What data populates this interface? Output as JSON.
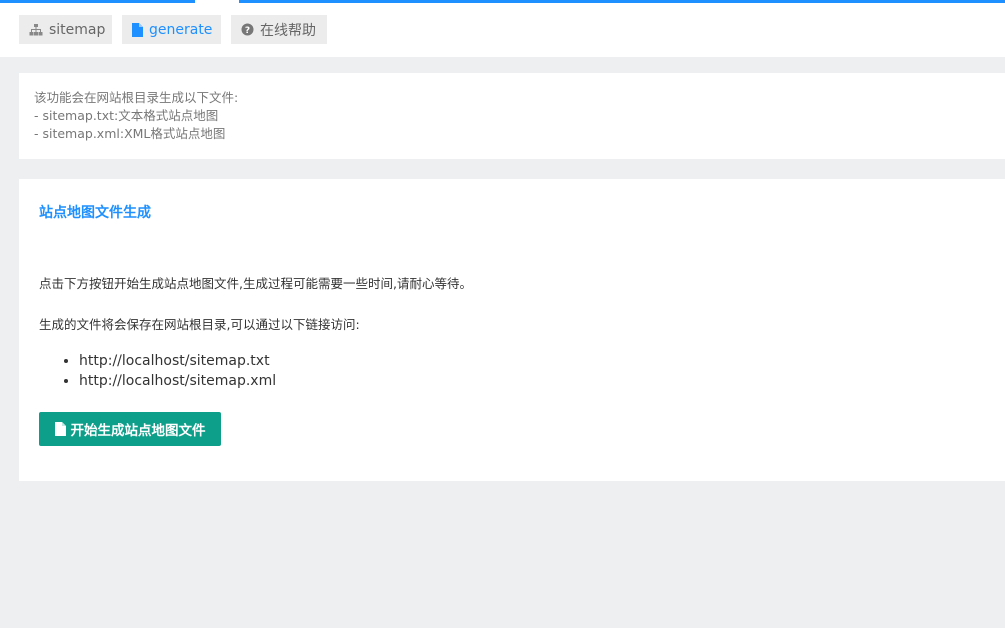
{
  "tabs": [
    {
      "label": "sitemap",
      "icon": "sitemap-icon",
      "active": false
    },
    {
      "label": "generate",
      "icon": "file-icon",
      "active": true
    },
    {
      "label": "在线帮助",
      "icon": "question-circle-icon",
      "active": false
    }
  ],
  "notice": {
    "line1": "该功能会在网站根目录生成以下文件:",
    "line2": "- sitemap.txt:文本格式站点地图",
    "line3": "- sitemap.xml:XML格式站点地图"
  },
  "card": {
    "title": "站点地图文件生成",
    "para1": "点击下方按钮开始生成站点地图文件,生成过程可能需要一些时间,请耐心等待。",
    "para2": "生成的文件将会保存在网站根目录,可以通过以下链接访问:",
    "links": [
      "http://localhost/sitemap.txt",
      "http://localhost/sitemap.xml"
    ],
    "button_label": "开始生成站点地图文件",
    "button_icon": "file-icon"
  },
  "colors": {
    "accent": "#1e90ff",
    "button": "#0e9f8a",
    "background": "#eeeff1"
  }
}
